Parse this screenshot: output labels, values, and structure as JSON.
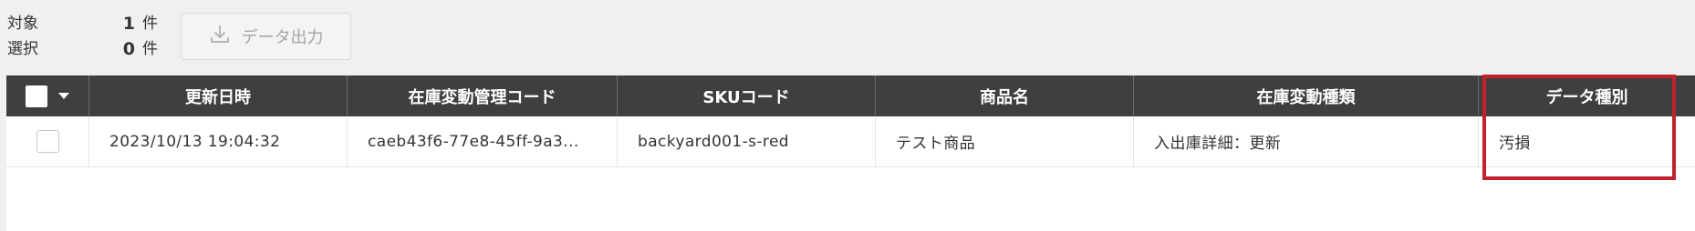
{
  "summary": {
    "target_label": "対象",
    "target_count": "1",
    "selected_label": "選択",
    "selected_count": "0",
    "unit": "件"
  },
  "export_button": {
    "label": "データ出力",
    "icon": "download-icon"
  },
  "table": {
    "columns": [
      "更新日時",
      "在庫変動管理コード",
      "SKUコード",
      "商品名",
      "在庫変動種類",
      "データ種別"
    ],
    "rows": [
      {
        "checked": false,
        "cells": [
          "2023/10/13 19:04:32",
          "caeb43f6-77e8-45ff-9a3...",
          "backyard001-s-red",
          "テスト商品",
          "入出庫詳細：更新",
          "汚損"
        ]
      }
    ]
  },
  "colors": {
    "header_bg": "#3f3f3f",
    "highlight": "#c0222a",
    "page_bg": "#f0f0f0"
  }
}
